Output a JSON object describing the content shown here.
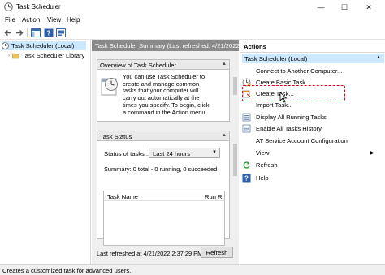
{
  "window": {
    "title": "Task Scheduler",
    "controls": {
      "minimize": "—",
      "maximize": "☐",
      "close": "✕"
    }
  },
  "menu": [
    "File",
    "Action",
    "View",
    "Help"
  ],
  "toolbar_icons": [
    "back-arrow-icon",
    "forward-arrow-icon",
    "show-hide-tree-icon",
    "help-icon",
    "properties-icon"
  ],
  "tree": {
    "items": [
      {
        "label": "Task Scheduler (Local)",
        "selected": true
      },
      {
        "label": "Task Scheduler Library",
        "selected": false
      }
    ]
  },
  "center": {
    "header": "Task Scheduler Summary (Last refreshed: 4/21/2022 2:37",
    "overview": {
      "title": "Overview of Task Scheduler",
      "lines": [
        "You can use Task Scheduler to",
        "create and manage common",
        "tasks that your computer will",
        "carry out automatically at the",
        "times you specify. To begin, click",
        "a command in the Action menu."
      ]
    },
    "task_status": {
      "title": "Task Status",
      "status_label": "Status of tasks ...",
      "select_value": "Last 24 hours",
      "summary": "Summary: 0 total - 0 running, 0 succeeded,",
      "col_name": "Task Name",
      "col_run": "Run R"
    },
    "last_refreshed": "Last refreshed at 4/21/2022 2:37:29 PM",
    "refresh_button": "Refresh"
  },
  "actions": {
    "title": "Actions",
    "group": "Task Scheduler (Local)",
    "items": [
      {
        "label": "Connect to Another Computer...",
        "icon": "computer-icon"
      },
      {
        "label": "Create Basic Task...",
        "icon": "basic-task-icon"
      },
      {
        "label": "Create Task...",
        "icon": "create-task-icon"
      },
      {
        "label": "Import Task...",
        "icon": "none"
      },
      {
        "label": "Display All Running Tasks",
        "icon": "running-tasks-icon"
      },
      {
        "label": "Enable All Tasks History",
        "icon": "history-icon"
      },
      {
        "label": "AT Service Account Configuration",
        "icon": "none"
      },
      {
        "label": "View",
        "icon": "none",
        "submenu": "▶"
      },
      {
        "label": "Refresh",
        "icon": "refresh-icon"
      },
      {
        "label": "Help",
        "icon": "help-icon"
      }
    ],
    "highlight_color": "#e0001b"
  },
  "status_bar": "Creates a customized task for advanced users."
}
